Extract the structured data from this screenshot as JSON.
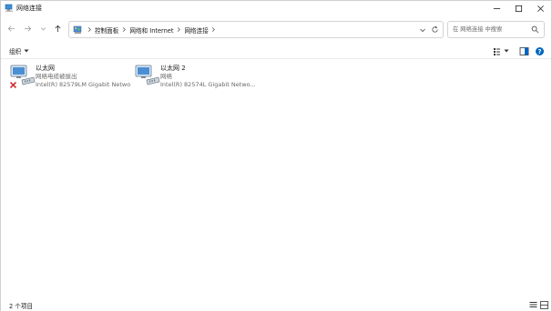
{
  "window": {
    "title": "网络连接"
  },
  "address": {
    "crumbs": [
      "控制面板",
      "网络和 Internet",
      "网络连接"
    ]
  },
  "search": {
    "placeholder": "在 网络连接 中搜索"
  },
  "command_bar": {
    "organize_label": "组织"
  },
  "adapters": [
    {
      "name": "以太网",
      "status": "网络电缆被拔出",
      "device": "Intel(R) 82579LM Gigabit Netwo...",
      "disconnected": true
    },
    {
      "name": "以太网 2",
      "status": "网络",
      "device": "Intel(R) 82574L Gigabit Netwo...",
      "disconnected": false
    }
  ],
  "status_bar": {
    "item_count": "2 个项目"
  },
  "colors": {
    "accent": "#0067c0",
    "error": "#d13438",
    "text": "#1a1a1a",
    "muted": "#6a6a6a"
  },
  "icons": {
    "title": "network-connections-icon",
    "back": "arrow-left-icon",
    "forward": "arrow-right-icon",
    "recent": "chevron-down-icon",
    "up": "arrow-up-icon",
    "refresh": "refresh-icon",
    "search": "search-icon",
    "view": "view-options-icon",
    "preview": "preview-pane-icon",
    "help": "help-icon",
    "adapter": "network-adapter-icon",
    "disconnected": "red-x-icon"
  }
}
